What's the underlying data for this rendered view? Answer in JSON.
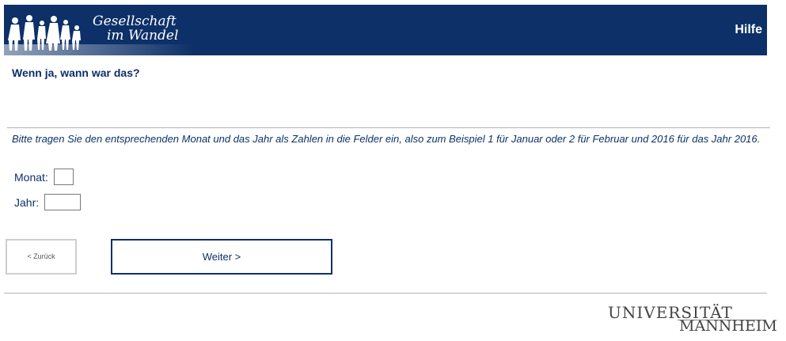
{
  "header": {
    "logo_line1": "Gesellschaft",
    "logo_line2": "im Wandel",
    "help_label": "Hilfe"
  },
  "question": {
    "title": "Wenn ja, wann war das?",
    "instruction": "Bitte tragen Sie den entsprechenden Monat und das Jahr als Zahlen in die Felder ein, also zum Beispiel 1 für Januar oder 2 für Februar und 2016 für das Jahr 2016."
  },
  "fields": {
    "month_label": "Monat:",
    "month_value": "",
    "year_label": "Jahr:",
    "year_value": ""
  },
  "nav": {
    "back_label": "< Zurück",
    "next_label": "Weiter >"
  },
  "footer": {
    "uni_line1": "UNIVERSITÄT",
    "uni_line2": "MANNHEIM"
  },
  "colors": {
    "brand": "#0d3068",
    "rule": "#b4b4b4"
  }
}
